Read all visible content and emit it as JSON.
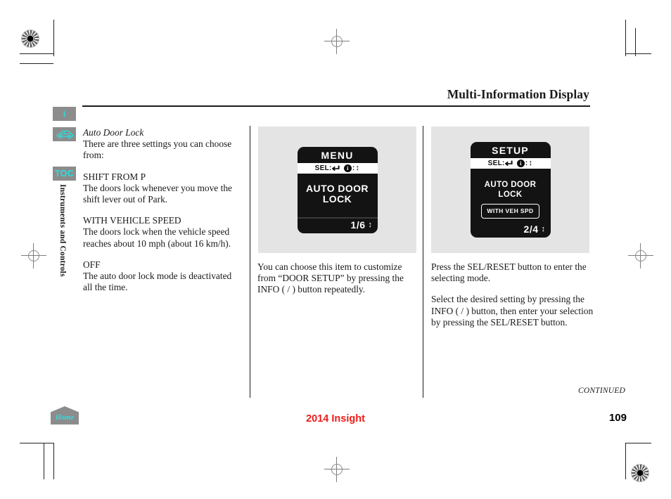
{
  "header": {
    "title": "Multi-Information Display"
  },
  "sidebar": {
    "buttons": [
      {
        "name": "info",
        "label": "i"
      },
      {
        "name": "car",
        "label": ""
      },
      {
        "name": "toc",
        "label": "TOC"
      }
    ],
    "section_tab": "Instruments and Controls",
    "home_label": "Home"
  },
  "columns": {
    "left": {
      "heading": "Auto Door Lock",
      "intro": "There are three settings you can choose from:",
      "options": [
        {
          "title": "SHIFT FROM P",
          "desc": "The doors lock whenever you move the shift lever out of Park."
        },
        {
          "title": "WITH VEHICLE SPEED",
          "desc": "The doors lock when the vehicle speed reaches about 10 mph (about 16 km/h)."
        },
        {
          "title": "OFF",
          "desc": "The auto door lock mode is deactivated all the time."
        }
      ]
    },
    "middle": {
      "paragraph": "You can choose this item to customize from “DOOR SETUP” by pressing the INFO (   /   ) button repeatedly."
    },
    "right": {
      "paragraph1": "Press the SEL/RESET button to enter the selecting mode.",
      "paragraph2": "Select the desired setting by pressing the INFO (   /   ) button, then enter your selection by pressing the SEL/RESET button."
    }
  },
  "figures": [
    {
      "name": "menu-screen",
      "title": "MENU",
      "bar": {
        "sel_label": "SEL:",
        "sel_glyph": "↵",
        "info_glyph": "i",
        "info_separator": ":",
        "updown_glyph": "↕"
      },
      "body_lines": [
        "AUTO DOOR",
        "LOCK"
      ],
      "page_indicator": "1/6",
      "page_arrows": "↕"
    },
    {
      "name": "setup-screen",
      "title": "SETUP",
      "bar": {
        "sel_label": "SEL:",
        "sel_glyph": "↵",
        "info_glyph": "i",
        "info_separator": ":",
        "updown_glyph": "↕"
      },
      "body_lines": [
        "AUTO DOOR LOCK"
      ],
      "selected_value": "WITH VEH SPD",
      "page_indicator": "2/4",
      "page_arrows": "↕"
    }
  ],
  "footer": {
    "continued": "CONTINUED",
    "model": "2014 Insight",
    "page_number": "109"
  },
  "colors": {
    "accent_red": "#ee1b19",
    "tab_cyan": "#29e0e0",
    "tab_gray": "#8c8c8c",
    "figure_bg": "#e4e4e4",
    "lcd_bg": "#131313"
  }
}
